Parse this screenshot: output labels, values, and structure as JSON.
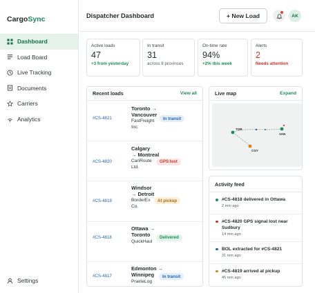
{
  "brand": {
    "name": "Cargo",
    "accent": "Sync",
    "accent_color": "#1e8a5a"
  },
  "sidebar": {
    "items": [
      {
        "label": "Dashboard",
        "icon": "grid-icon",
        "active": true
      },
      {
        "label": "Load Board",
        "icon": "list-icon",
        "active": false
      },
      {
        "label": "Live Tracking",
        "icon": "clock-icon",
        "active": false
      },
      {
        "label": "Documents",
        "icon": "document-icon",
        "active": false
      },
      {
        "label": "Carriers",
        "icon": "star-icon",
        "active": false
      },
      {
        "label": "Analytics",
        "icon": "signal-icon",
        "active": false
      }
    ],
    "settings": {
      "label": "Settings",
      "icon": "user-icon"
    }
  },
  "header": {
    "title": "Dispatcher Dashboard",
    "new_load_label": "+ New Load",
    "notifications_icon": "bell-icon",
    "avatar_initials": "AK"
  },
  "stats": [
    {
      "label": "Active loads",
      "value": "47",
      "sub": "+3 from yesterday",
      "tone": "green"
    },
    {
      "label": "In transit",
      "value": "31",
      "sub": "across 8 provinces",
      "tone": "neutral"
    },
    {
      "label": "On-time rate",
      "value": "94%",
      "sub": "+2% this week",
      "tone": "green"
    },
    {
      "label": "Alerts",
      "value": "2",
      "sub": "Needs attention",
      "tone": "red"
    }
  ],
  "recent_loads": {
    "title": "Recent loads",
    "view_all_label": "View all",
    "rows": [
      {
        "id": "#CS-4821",
        "origin": "Toronto",
        "destination": "Vancouver",
        "arrow": "→",
        "carrier": "FastFreight Inc.",
        "status": "In transit"
      },
      {
        "id": "#CS-4820",
        "origin": "Calgary",
        "destination": "Montreal",
        "arrow": "→",
        "carrier": "CanRoute Ltd.",
        "status": "GPS lost"
      },
      {
        "id": "#CS-4819",
        "origin": "Windsor",
        "destination": "Detroit",
        "arrow": "→",
        "carrier": "BorderEx Co.",
        "status": "At pickup"
      },
      {
        "id": "#CS-4818",
        "origin": "Ottawa",
        "destination": "Toronto",
        "arrow": "→",
        "carrier": "QuickHaul",
        "status": "Delivered"
      },
      {
        "id": "#CS-4817",
        "origin": "Edmonton",
        "destination": "Winnipeg",
        "arrow": "→",
        "carrier": "PrairieLog",
        "status": "In transit"
      }
    ]
  },
  "status_colors": {
    "In transit": {
      "bg": "#e3eefa",
      "fg": "#2563a8"
    },
    "GPS lost": {
      "bg": "#fbe6e4",
      "fg": "#c2362f"
    },
    "At pickup": {
      "bg": "#fbefd9",
      "fg": "#a86a12"
    },
    "Delivered": {
      "bg": "#e2f3e9",
      "fg": "#1e8a5a"
    }
  },
  "live_map": {
    "title": "Live map",
    "expand_label": "Expand",
    "markers": [
      {
        "label": "TOR",
        "color": "#1e8a5a"
      },
      {
        "label": "VAN",
        "color": "#1e8a5a"
      },
      {
        "label": "CGY",
        "color": "#d9831f"
      }
    ]
  },
  "activity_feed": {
    "title": "Activity feed",
    "items": [
      {
        "text": "#CS-4818 delivered in Ottawa",
        "time": "2 min ago",
        "color": "#1e8a5a"
      },
      {
        "text": "#CS-4820 GPS signal lost near Sudbury",
        "time": "14 min ago",
        "color": "#c2362f"
      },
      {
        "text": "BOL extracted for #CS-4821",
        "time": "31 min ago",
        "color": "#2563a8"
      },
      {
        "text": "#CS-4819 arrived at pickup",
        "time": "45 min ago",
        "color": "#d9831f"
      }
    ]
  }
}
